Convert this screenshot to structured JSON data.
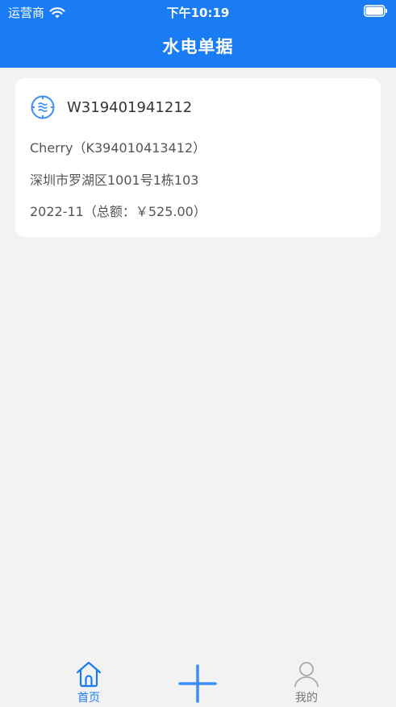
{
  "status_bar": {
    "carrier": "运营商",
    "time": "下午10:19"
  },
  "nav": {
    "title": "水电单据"
  },
  "bill_card": {
    "icon": "water-meter-icon",
    "bill_number": "W319401941212",
    "customer": "Cherry（K394010413412）",
    "address": "深圳市罗湖区1001号1栋103",
    "period_total": "2022-11（总额：￥525.00）"
  },
  "tabbar": {
    "home_label": "首页",
    "mine_label": "我的",
    "add_icon": "plus-icon"
  },
  "colors": {
    "brand": "#1a7cf5",
    "background": "#f2f2f2",
    "card": "#ffffff",
    "inactive": "#999999"
  }
}
